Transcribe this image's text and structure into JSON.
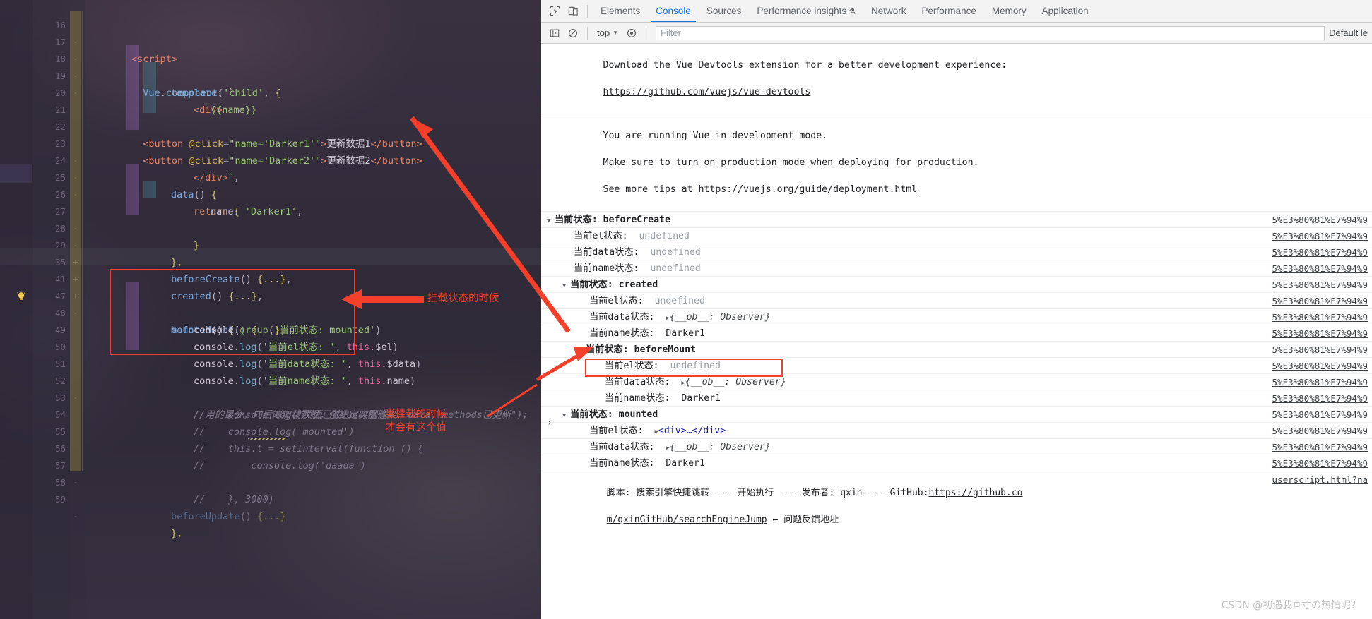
{
  "editor": {
    "lines": [
      {
        "n": "16",
        "fold": "-",
        "indent": 0
      },
      {
        "n": "17",
        "fold": "-",
        "indent": 0
      },
      {
        "n": "18",
        "fold": "-",
        "indent": 0
      },
      {
        "n": "19",
        "fold": "-",
        "indent": 0
      },
      {
        "n": "20",
        "fold": "",
        "indent": 0
      },
      {
        "n": "21",
        "fold": "",
        "indent": 0
      },
      {
        "n": "22",
        "fold": "",
        "indent": 0
      },
      {
        "n": "23",
        "fold": "-",
        "indent": 0
      },
      {
        "n": "24",
        "fold": "-",
        "indent": 0
      },
      {
        "n": "25",
        "fold": "-",
        "indent": 0
      },
      {
        "n": "26",
        "fold": "",
        "indent": 0
      },
      {
        "n": "27",
        "fold": "-",
        "indent": 0
      },
      {
        "n": "28",
        "fold": "-",
        "indent": 0
      },
      {
        "n": "29",
        "fold": "+",
        "indent": 0
      },
      {
        "n": "35",
        "fold": "+",
        "indent": 0
      },
      {
        "n": "41",
        "fold": "+",
        "indent": 0
      },
      {
        "n": "47",
        "fold": "-",
        "indent": 0
      },
      {
        "n": "48",
        "fold": "",
        "indent": 0
      },
      {
        "n": "49",
        "fold": "",
        "indent": 0
      },
      {
        "n": "50",
        "fold": "",
        "indent": 0
      },
      {
        "n": "51",
        "fold": "",
        "indent": 0
      },
      {
        "n": "52",
        "fold": "-",
        "indent": 0
      },
      {
        "n": "53",
        "fold": "",
        "indent": 0
      },
      {
        "n": "54",
        "fold": "",
        "indent": 0
      },
      {
        "n": "55",
        "fold": "",
        "indent": 0
      },
      {
        "n": "56",
        "fold": "",
        "indent": 0
      },
      {
        "n": "57",
        "fold": "-",
        "indent": 0
      },
      {
        "n": "58",
        "fold": "",
        "indent": 0
      },
      {
        "n": "59",
        "fold": "-",
        "indent": 0
      }
    ],
    "code": {
      "l16": "<script>",
      "l17": "Vue.component('child', {",
      "l18": "template: `",
      "l19": "<div>",
      "l20": "{{name}}",
      "l21": "<button @click=\"name='Darker1'\">更新数据1</button>",
      "l22": "<button @click=\"name='Darker2'\">更新数据2</button>",
      "l23": "</div>`,",
      "l24": "data() {",
      "l25": "return {",
      "l26": "name: 'Darker1',",
      "l27": "}",
      "l28": "},",
      "l29": "beforeCreate() {...},",
      "l35": "created() {...},",
      "l41": "beforeMount() {...},",
      "l47": "mounted() {",
      "l48": "console.group('当前状态: mounted')",
      "l49": "console.log('当前el状态: ', this.$el)",
      "l50": "console.log('当前data状态: ', this.$data)",
      "l51": "console.log('当前name状态: ', this.name)",
      "l52": "//用的最多，向后端加载数据，创建定时器等",
      "l53": "//    console.log(\"页面已被vue实例渲染, data, methods已更新\");",
      "l54": "//    console.log('mounted')",
      "l55": "//    this.t = setInterval(function () {",
      "l56": "//        console.log('daada')",
      "l57": "//    }, 3000)",
      "l58": "",
      "l59": "},"
    },
    "annotations": {
      "a1": "挂载状态的时候",
      "a2": "当挂载的时候\n才会有这个值"
    }
  },
  "devtools": {
    "tabs": [
      {
        "label": "Elements",
        "active": false
      },
      {
        "label": "Console",
        "active": true
      },
      {
        "label": "Sources",
        "active": false
      },
      {
        "label": "Performance insights",
        "active": false,
        "flask": true
      },
      {
        "label": "Network",
        "active": false
      },
      {
        "label": "Performance",
        "active": false
      },
      {
        "label": "Memory",
        "active": false
      },
      {
        "label": "Application",
        "active": false
      }
    ],
    "toolbar": {
      "inspect_icon": "inspect-element-icon",
      "device_icon": "device-toolbar-icon"
    },
    "filterbar": {
      "sidebar_icon": "console-sidebar-icon",
      "clear_icon": "clear-console-icon",
      "context": "top",
      "eye_icon": "live-expression-icon",
      "filter_placeholder": "Filter",
      "filter_value": "",
      "levels": "Default le"
    },
    "console": {
      "messages": [
        {
          "id": "vue-devtools",
          "line1": "Download the Vue Devtools extension for a better development experience:",
          "link": "https://github.com/vuejs/vue-devtools",
          "source": ""
        },
        {
          "id": "vue-devmode",
          "line1": "You are running Vue in development mode.",
          "line2": "Make sure to turn on production mode when deploying for production.",
          "line3_pre": "See more tips at ",
          "line3_link": "https://vuejs.org/guide/deployment.html",
          "source": ""
        }
      ],
      "groups": [
        {
          "title_prefix": "当前状态: ",
          "title": "beforeCreate",
          "source": "5%E3%80%81%E7%94%9",
          "rows": [
            {
              "label": "当前el状态:",
              "value": "undefined",
              "type": "undef",
              "source": "5%E3%80%81%E7%94%9"
            },
            {
              "label": "当前data状态:",
              "value": "undefined",
              "type": "undef",
              "source": "5%E3%80%81%E7%94%9"
            },
            {
              "label": "当前name状态:",
              "value": "undefined",
              "type": "undef",
              "source": "5%E3%80%81%E7%94%9"
            }
          ]
        },
        {
          "title_prefix": "当前状态: ",
          "title": "created",
          "source": "5%E3%80%81%E7%94%9",
          "rows": [
            {
              "label": "当前el状态:",
              "value": "undefined",
              "type": "undef",
              "source": "5%E3%80%81%E7%94%9"
            },
            {
              "label": "当前data状态:",
              "value": "{__ob__: Observer}",
              "type": "obj",
              "source": "5%E3%80%81%E7%94%9"
            },
            {
              "label": "当前name状态:",
              "value": "Darker1",
              "type": "plain",
              "source": "5%E3%80%81%E7%94%9"
            }
          ]
        },
        {
          "title_prefix": "当前状态: ",
          "title": "beforeMount",
          "source": "5%E3%80%81%E7%94%9",
          "rows": [
            {
              "label": "当前el状态:",
              "value": "undefined",
              "type": "undef",
              "source": "5%E3%80%81%E7%94%9"
            },
            {
              "label": "当前data状态:",
              "value": "{__ob__: Observer}",
              "type": "obj",
              "source": "5%E3%80%81%E7%94%9"
            },
            {
              "label": "当前name状态:",
              "value": "Darker1",
              "type": "plain",
              "source": "5%E3%80%81%E7%94%9"
            }
          ]
        },
        {
          "title_prefix": "当前状态: ",
          "title": "mounted",
          "source": "5%E3%80%81%E7%94%9",
          "rows": [
            {
              "label": "当前el状态:",
              "value": "<div>…</div>",
              "type": "dom",
              "highlight": true,
              "source": "5%E3%80%81%E7%94%9"
            },
            {
              "label": "当前data状态:",
              "value": "{__ob__: Observer}",
              "type": "obj",
              "source": "5%E3%80%81%E7%94%9"
            },
            {
              "label": "当前name状态:",
              "value": "Darker1",
              "type": "plain",
              "source": "5%E3%80%81%E7%94%9"
            }
          ]
        }
      ],
      "script_note": {
        "line1": "脚本: 搜索引擎快捷跳转 --- 开始执行 --- 发布者: qxin --- GitHub:",
        "link1": "https://github.co",
        "line2_link": "m/qxinGitHub/searchEngineJump",
        "line2_tail": " ← 问题反馈地址",
        "source_right": "userscript.html?na"
      },
      "prompt_symbol": "›"
    },
    "watermark": "CSDN @初遇我ㅁ寸の热情呢？"
  }
}
